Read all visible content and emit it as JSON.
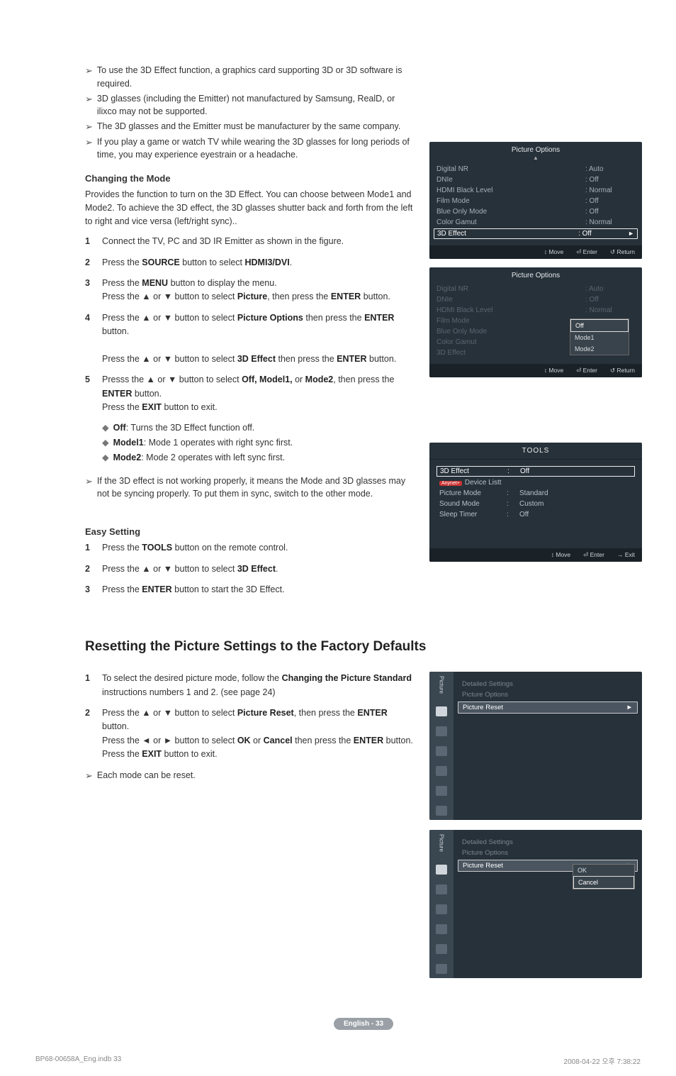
{
  "notes": [
    "To use the 3D Effect function, a graphics card supporting 3D or 3D software is required.",
    "3D glasses (including the Emitter) not manufactured by Samsung, RealD, or ilixco may not be supported.",
    "The 3D glasses and the Emitter must be manufacturer by the same company.",
    "If you play a game or watch TV while wearing the 3D glasses for long periods of time, you may experience eyestrain or a headache."
  ],
  "changing_mode": {
    "title": "Changing the Mode",
    "intro": "Provides the function to turn on the 3D Effect. You can choose between Mode1 and Mode2. To achieve the 3D effect, the 3D glasses shutter back and forth from the left to right and vice versa (left/right sync)..",
    "steps": [
      {
        "n": "1",
        "body": "Connect the TV, PC and 3D IR Emitter as shown in the figure."
      },
      {
        "n": "2",
        "body": "Press the <b>SOURCE</b> button to select <b>HDMI3/DVI</b>."
      },
      {
        "n": "3",
        "body": "Press the <b>MENU</b> button to display the menu.<br>Press the ▲ or ▼ button to select <b>Picture</b>, then press the <b>ENTER</b> button."
      },
      {
        "n": "4",
        "body": "Press the ▲ or ▼ button to select <b>Picture Options</b> then press the <b>ENTER</b> button.<br><br>Press the ▲ or ▼ button to select <b>3D Effect</b> then press the <b>ENTER</b> button."
      },
      {
        "n": "5",
        "body": "Presss the ▲ or ▼ button to select <b>Off, Model1,</b> or <b>Mode2</b>, then press the <b>ENTER</b> button.<br>Press the <b>EXIT</b> button to exit."
      }
    ],
    "subbullets": [
      "<b>Off</b>: Turns the 3D Effect function off.",
      "<b>Model1</b>: Mode 1 operates with right sync first.",
      "<b>Mode2</b>: Mode 2 operates with left sync first."
    ],
    "note_after": "If the 3D effect is not working properly, it means the Mode and 3D glasses may not be syncing properly. To put them in sync, switch to the other mode."
  },
  "easy": {
    "title": "Easy Setting",
    "steps": [
      {
        "n": "1",
        "body": "Press the <b>TOOLS</b> button on the remote control."
      },
      {
        "n": "2",
        "body": "Press the ▲ or ▼ button to select <b>3D Effect</b>."
      },
      {
        "n": "3",
        "body": "Press the <b>ENTER</b> button to start the 3D Effect."
      }
    ]
  },
  "reset": {
    "heading": "Resetting the Picture Settings to the Factory Defaults",
    "steps": [
      {
        "n": "1",
        "body": "To select the desired picture mode, follow the <b>Changing the Picture Standard</b> instructions numbers 1 and 2. (see page 24)"
      },
      {
        "n": "2",
        "body": "Press the ▲ or ▼ button to select <b>Picture Reset</b>, then press the <b>ENTER</b> button.<br>Press the ◄ or ► button to select <b>OK</b> or <b>Cancel</b> then press the <b>ENTER</b> button.<br>Press the <b>EXIT</b> button to exit."
      }
    ],
    "note": "Each mode can be reset."
  },
  "osd1": {
    "title": "Picture Options",
    "rows": [
      {
        "l": "Digital NR",
        "v": ": Auto"
      },
      {
        "l": "DNIe",
        "v": ": Off"
      },
      {
        "l": "HDMI Black Level",
        "v": ": Normal"
      },
      {
        "l": "Film Mode",
        "v": ": Off"
      },
      {
        "l": "Blue Only Mode",
        "v": ": Off"
      },
      {
        "l": "Color Gamut",
        "v": ": Normal"
      },
      {
        "l": "3D Effect",
        "v": ": Off",
        "hl": true,
        "arrow": true
      }
    ],
    "foot": [
      "↕ Move",
      "⏎ Enter",
      "↺ Return"
    ]
  },
  "osd2": {
    "title": "Picture Options",
    "rows": [
      {
        "l": "Digital NR",
        "v": ": Auto",
        "dim": true
      },
      {
        "l": "DNIe",
        "v": ": Off",
        "dim": true
      },
      {
        "l": "HDMI Black Level",
        "v": ": Normal",
        "dim": true
      },
      {
        "l": "Film Mode",
        "v": ":",
        "dim": true
      },
      {
        "l": "Blue Only Mode",
        "v": ":",
        "dim": true
      },
      {
        "l": "Color Gamut",
        "v": ":",
        "dim": true
      },
      {
        "l": "3D Effect",
        "v": ":",
        "dim": true
      }
    ],
    "dropdown": [
      "Off",
      "Mode1",
      "Mode2"
    ],
    "foot": [
      "↕ Move",
      "⏎ Enter",
      "↺ Return"
    ]
  },
  "tools": {
    "title": "TOOLS",
    "rows": [
      {
        "l": "3D Effect",
        "v": "Off",
        "hl": true
      },
      {
        "l": "Device Listt",
        "v": "",
        "anynet": true
      },
      {
        "l": "Picture Mode",
        "v": "Standard"
      },
      {
        "l": "Sound Mode",
        "v": "Custom"
      },
      {
        "l": "Sleep Timer",
        "v": "Off"
      }
    ],
    "foot": [
      "↕ Move",
      "⏎ Enter",
      "→ Exit"
    ]
  },
  "pic1": {
    "sidebar_label": "Picture",
    "items": [
      "Detailed Settings",
      "Picture Options"
    ],
    "highlight": "Picture Reset"
  },
  "pic2": {
    "sidebar_label": "Picture",
    "items": [
      "Detailed Settings",
      "Picture Options"
    ],
    "highlight": "Picture Reset",
    "popup": [
      "OK",
      "Cancel"
    ]
  },
  "footer_pill": "English - 33",
  "bottom": {
    "left": "BP68-00658A_Eng.indb   33",
    "right": "2008-04-22   오후 7:38:22"
  }
}
